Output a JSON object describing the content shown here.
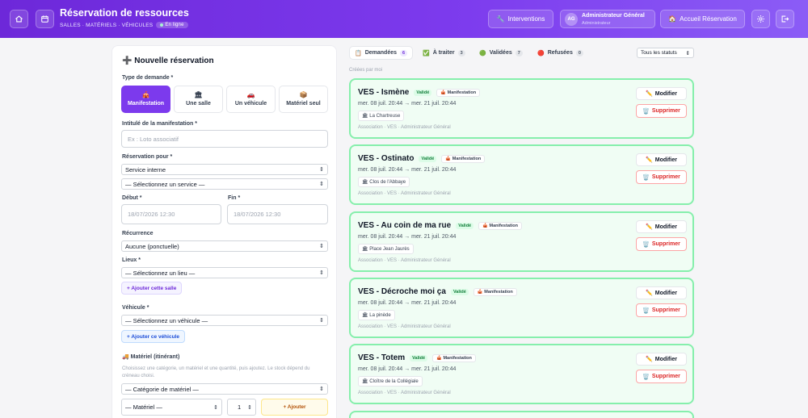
{
  "header": {
    "title": "Réservation de ressources",
    "subtitle": "SALLES · MATÉRIELS · VÉHICULES",
    "status_badge": "En ligne",
    "interventions_label": "Interventions",
    "user": {
      "initials": "AG",
      "name": "Administrateur Général",
      "role": "Administrateur"
    },
    "accueil_label": "Accueil Réservation",
    "icons": [
      "home-icon",
      "calendar-icon",
      "wrench-icon",
      "house-icon",
      "gear-icon",
      "logout-icon"
    ]
  },
  "form": {
    "title": "Nouvelle réservation",
    "type_label": "Type de demande *",
    "types": [
      {
        "label": "Manifestation",
        "icon": "🎪",
        "active": true
      },
      {
        "label": "Une salle",
        "icon": "🏛",
        "active": false
      },
      {
        "label": "Un véhicule",
        "icon": "🚗",
        "active": false
      },
      {
        "label": "Matériel seul",
        "icon": "📦",
        "active": false
      }
    ],
    "intitule_label": "Intitulé de la manifestation *",
    "intitule_placeholder": "Ex : Loto associatif",
    "reservation_pour_label": "Réservation pour *",
    "reservation_pour_value": "Service interne",
    "service_value": "— Sélectionnez un service —",
    "debut_label": "Début *",
    "debut_value": "18/07/2026 12:30",
    "fin_label": "Fin *",
    "fin_value": "18/07/2026 12:30",
    "recurrence_label": "Récurrence",
    "recurrence_value": "Aucune (ponctuelle)",
    "lieux_label": "Lieux *",
    "lieux_value": "— Sélectionnez un lieu —",
    "add_salle_label": "+ Ajouter cette salle",
    "vehicule_label": "Véhicule *",
    "vehicule_value": "— Sélectionnez un véhicule —",
    "add_vehicule_label": "+ Ajouter ce véhicule",
    "materiel_label": "Matériel (itinérant)",
    "materiel_help": "Choisissez une catégorie, un matériel et une quantité, puis ajoutez. Le stock dépend du créneau choisi.",
    "categorie_value": "— Catégorie de matériel —",
    "materiel_value": "— Matériel —",
    "quantite_value": "1",
    "add_materiel_label": "+ Ajouter"
  },
  "tabs": [
    {
      "label": "Demandées",
      "count": "6",
      "icon": "📋",
      "active": true
    },
    {
      "label": "À traiter",
      "count": "3",
      "icon": "✅",
      "active": false
    },
    {
      "label": "Validées",
      "count": "7",
      "icon": "🟢",
      "active": false
    },
    {
      "label": "Refusées",
      "count": "0",
      "icon": "🔴",
      "active": false
    }
  ],
  "status_filter": "Tous les statuts",
  "sort_label": "Créées par moi",
  "card_labels": {
    "status": "Validé",
    "type": "Manifestation",
    "edit": "Modifier",
    "delete": "Supprimer"
  },
  "cards": [
    {
      "title": "VES - Ismène",
      "dates": "mer. 08 juil. 20:44 → mer. 21 juil. 20:44",
      "place": "La Chartreuse",
      "meta": "Association · VES · Administrateur Général"
    },
    {
      "title": "VES - Ostinato",
      "dates": "mer. 08 juil. 20:44 → mer. 21 juil. 20:44",
      "place": "Clos de l'Abbaye",
      "meta": "Association · VES · Administrateur Général"
    },
    {
      "title": "VES - Au coin de ma rue",
      "dates": "mer. 08 juil. 20:44 → mer. 21 juil. 20:44",
      "place": "Place Jean Jaurès",
      "meta": "Association · VES · Administrateur Général"
    },
    {
      "title": "VES - Décroche moi ça",
      "dates": "mer. 08 juil. 20:44 → mer. 21 juil. 20:44",
      "place": "La pinède",
      "meta": "Association · VES · Administrateur Général"
    },
    {
      "title": "VES - Totem",
      "dates": "mer. 08 juil. 20:44 → mer. 21 juil. 20:44",
      "place": "Cloître de la Collégiale",
      "meta": "Association · VES · Administrateur Général"
    }
  ]
}
